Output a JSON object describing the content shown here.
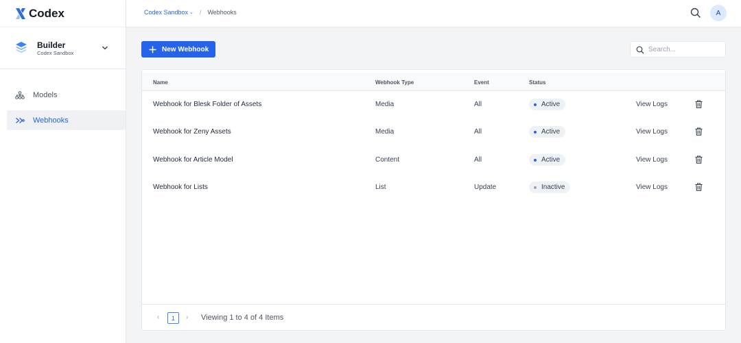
{
  "app": {
    "name": "Codex"
  },
  "project": {
    "name": "Builder",
    "subtitle": "Codex Sandbox"
  },
  "sidebar": {
    "items": [
      {
        "label": "Models",
        "icon": "models-icon",
        "active": false
      },
      {
        "label": "Webhooks",
        "icon": "webhooks-icon",
        "active": true
      }
    ]
  },
  "header": {
    "breadcrumb": {
      "workspace": "Codex Sandbox",
      "separator": "/",
      "current": "Webhooks"
    },
    "avatar_initial": "A"
  },
  "toolbar": {
    "new_button_label": "New Webhook",
    "search_placeholder": "Search..."
  },
  "table": {
    "columns": [
      "Name",
      "Webhook Type",
      "Event",
      "Status"
    ],
    "rows": [
      {
        "name": "Webhook for Blesk Folder of Assets",
        "type": "Media",
        "event": "All",
        "status": "Active",
        "action": "View Logs"
      },
      {
        "name": "Webhook for Zeny Assets",
        "type": "Media",
        "event": "All",
        "status": "Active",
        "action": "View Logs"
      },
      {
        "name": "Webhook for Article Model",
        "type": "Content",
        "event": "All",
        "status": "Active",
        "action": "View Logs"
      },
      {
        "name": "Webhook for Lists",
        "type": "List",
        "event": "Update",
        "status": "Inactive",
        "action": "View Logs"
      }
    ]
  },
  "pagination": {
    "prev": "‹",
    "current_page": "1",
    "next": "›",
    "info": "Viewing 1 to 4 of 4 Items"
  },
  "colors": {
    "accent": "#2563eb",
    "status_active_dot": "#2563eb",
    "status_inactive_dot": "#9ca3af",
    "logo_blue": "#2d6cdf",
    "logo_light": "#9cc0f5"
  }
}
